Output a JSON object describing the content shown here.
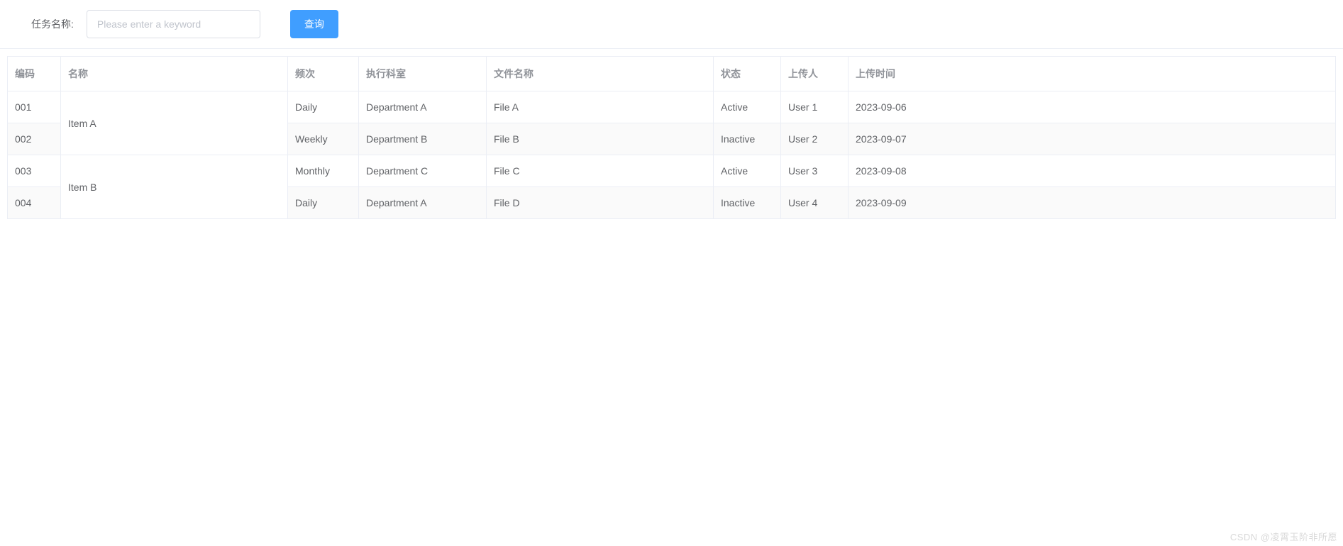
{
  "search": {
    "label": "任务名称:",
    "placeholder": "Please enter a keyword",
    "button": "查询"
  },
  "table": {
    "headers": {
      "code": "编码",
      "name": "名称",
      "freq": "频次",
      "dept": "执行科室",
      "file": "文件名称",
      "status": "状态",
      "uploader": "上传人",
      "uploadTime": "上传时间"
    },
    "rows": [
      {
        "code": "001",
        "name": "Item A",
        "nameRowspan": 2,
        "freq": "Daily",
        "dept": "Department A",
        "file": "File A",
        "status": "Active",
        "uploader": "User 1",
        "uploadTime": "2023-09-06",
        "striped": false
      },
      {
        "code": "002",
        "name": "Item A",
        "nameRowspan": 0,
        "freq": "Weekly",
        "dept": "Department B",
        "file": "File B",
        "status": "Inactive",
        "uploader": "User 2",
        "uploadTime": "2023-09-07",
        "striped": true
      },
      {
        "code": "003",
        "name": "Item B",
        "nameRowspan": 2,
        "freq": "Monthly",
        "dept": "Department C",
        "file": "File C",
        "status": "Active",
        "uploader": "User 3",
        "uploadTime": "2023-09-08",
        "striped": false
      },
      {
        "code": "004",
        "name": "Item B",
        "nameRowspan": 0,
        "freq": "Daily",
        "dept": "Department A",
        "file": "File D",
        "status": "Inactive",
        "uploader": "User 4",
        "uploadTime": "2023-09-09",
        "striped": true
      }
    ]
  },
  "watermark": "CSDN @凌霄玉阶非所愿"
}
